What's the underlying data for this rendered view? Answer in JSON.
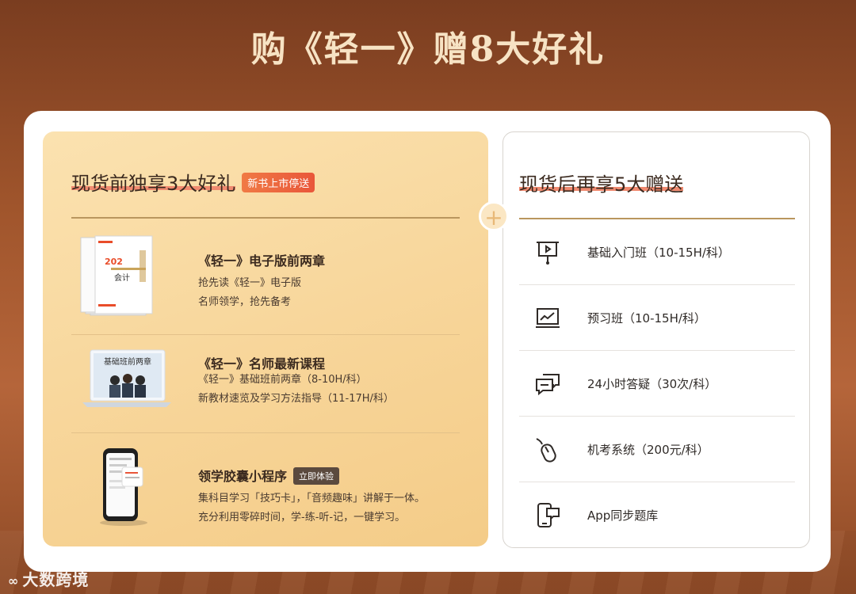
{
  "header": {
    "title": "购《轻一》赠8大好礼"
  },
  "left": {
    "title": "现货前独享3大好礼",
    "badge": "新书上市停送",
    "gifts": [
      {
        "title": "《轻一》电子版前两章",
        "lines": [
          "抢先读《轻一》电子版",
          "名师领学，抢先备考"
        ],
        "cover_label": "会计"
      },
      {
        "title": "《轻一》名师最新课程",
        "lines": [
          "《轻一》基础班前两章（8-10H/科）",
          "新教材速览及学习方法指导（11-17H/科）"
        ],
        "screen_label": "基础班前两章"
      },
      {
        "title": "领学胶囊小程序",
        "tag": "立即体验",
        "lines": [
          "集科目学习「技巧卡」，「音频趣味」讲解于一体。",
          "充分利用零碎时间，学-练-听-记，一键学习。"
        ]
      }
    ]
  },
  "right": {
    "title": "现货后再享5大赠送",
    "items": [
      {
        "label": "基础入门班（10-15H/科）",
        "icon": "presentation-board-icon"
      },
      {
        "label": "预习班（10-15H/科）",
        "icon": "monitor-chart-icon"
      },
      {
        "label": "24小时答疑（30次/科）",
        "icon": "chat-bubbles-icon"
      },
      {
        "label": "机考系统（200元/科）",
        "icon": "computer-mouse-icon"
      },
      {
        "label": "App同步题库",
        "icon": "phone-chat-icon"
      }
    ]
  },
  "watermark": "大数跨境",
  "colors": {
    "accent": "#e9563a",
    "gold": "#b9965e",
    "panel": "#f7d497"
  }
}
